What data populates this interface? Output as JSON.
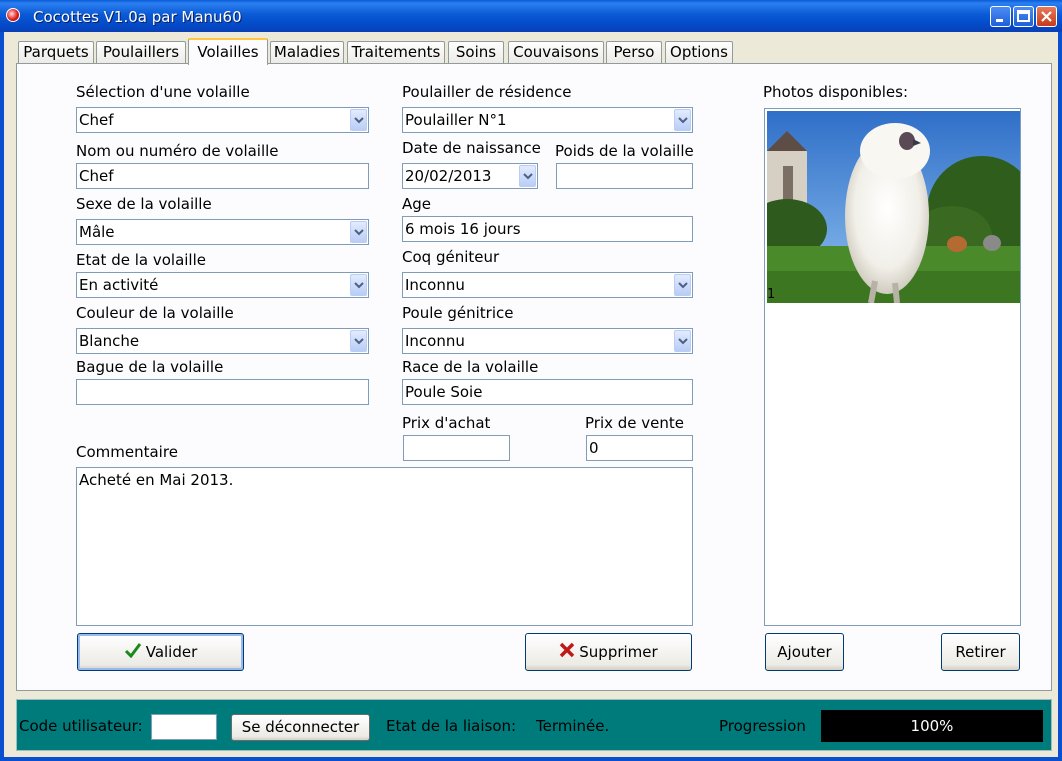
{
  "window": {
    "title": "Cocottes V1.0a par Manu60"
  },
  "tabs": [
    {
      "label": "Parquets"
    },
    {
      "label": "Poulaillers"
    },
    {
      "label": "Volailles"
    },
    {
      "label": "Maladies"
    },
    {
      "label": "Traitements"
    },
    {
      "label": "Soins"
    },
    {
      "label": "Couvaisons"
    },
    {
      "label": "Perso"
    },
    {
      "label": "Options"
    }
  ],
  "form": {
    "selection_label": "Sélection d'une volaille",
    "selection_value": "Chef",
    "nom_label": "Nom ou numéro de volaille",
    "nom_value": "Chef",
    "sexe_label": "Sexe de la volaille",
    "sexe_value": "Mâle",
    "etat_label": "Etat de la volaille",
    "etat_value": "En activité",
    "couleur_label": "Couleur de la volaille",
    "couleur_value": "Blanche",
    "bague_label": "Bague de la volaille",
    "bague_value": "",
    "poulailler_label": "Poulailler de résidence",
    "poulailler_value": "Poulailler N°1",
    "date_label": "Date de naissance",
    "date_value": "20/02/2013",
    "poids_label": "Poids de la volaille",
    "poids_value": "",
    "age_label": "Age",
    "age_value": "6 mois 16 jours",
    "coq_label": "Coq géniteur",
    "coq_value": "Inconnu",
    "poule_label": "Poule génitrice",
    "poule_value": "Inconnu",
    "race_label": "Race de la volaille",
    "race_value": "Poule Soie",
    "prix_achat_label": "Prix d'achat",
    "prix_achat_value": "",
    "prix_vente_label": "Prix de vente",
    "prix_vente_value": "0",
    "commentaire_label": "Commentaire",
    "commentaire_value": "Acheté en Mai 2013."
  },
  "buttons": {
    "valider": "Valider",
    "supprimer": "Supprimer",
    "ajouter": "Ajouter",
    "retirer": "Retirer"
  },
  "photos": {
    "label": "Photos disponibles:",
    "items": [
      {
        "number": "1",
        "icon": "silkie-chicken-photo"
      }
    ]
  },
  "status": {
    "code_label": "Code utilisateur:",
    "code_value": "",
    "disconnect_label": "Se déconnecter",
    "liaison_label": "Etat de la liaison:",
    "liaison_value": "Terminée.",
    "progress_label": "Progression",
    "progress_value": "100%"
  },
  "colors": {
    "titlebar": "#0a5ad6",
    "statusbar": "#007b7b",
    "progress_bg": "#000000",
    "active_tab_accent": "#ffc83c"
  }
}
